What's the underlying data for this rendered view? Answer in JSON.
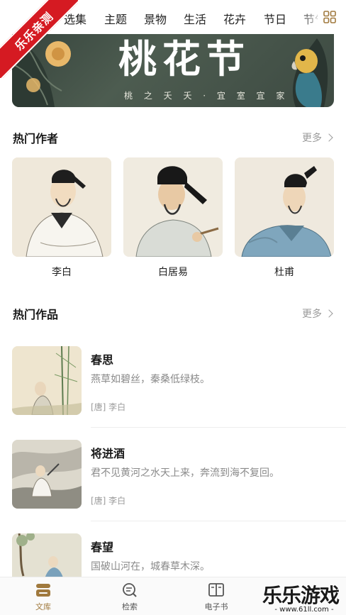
{
  "nav": {
    "tabs": [
      "选集",
      "主题",
      "景物",
      "生活",
      "花卉",
      "节日",
      "节气"
    ],
    "grid_icon": "grid-icon"
  },
  "watermark_ribbon": "乐乐亲测",
  "banner": {
    "title": "桃花节",
    "subtitle": "桃 之 夭 夭 · 宜 室 宜 家"
  },
  "hot_authors": {
    "title": "热门作者",
    "more": "更多",
    "items": [
      {
        "name": "李白"
      },
      {
        "name": "白居易"
      },
      {
        "name": "杜甫"
      }
    ]
  },
  "hot_works": {
    "title": "热门作品",
    "more": "更多",
    "items": [
      {
        "title": "春思",
        "line": "燕草如碧丝，秦桑低绿枝。",
        "author": "[唐] 李白"
      },
      {
        "title": "将进酒",
        "line": "君不见黄河之水天上来，奔流到海不复回。",
        "author": "[唐] 李白"
      },
      {
        "title": "春望",
        "line": "国破山河在，城春草木深。",
        "author": ""
      }
    ]
  },
  "tabbar": {
    "items": [
      {
        "label": "文库",
        "icon": "library-icon"
      },
      {
        "label": "检索",
        "icon": "search-icon"
      },
      {
        "label": "电子书",
        "icon": "book-icon"
      }
    ]
  },
  "watermark": {
    "big": "乐乐游戏",
    "small": "- www.61ll.com -"
  },
  "colors": {
    "accent": "#a0793d",
    "ribbon": "#d51a22",
    "banner_bg": "#3f4c44"
  }
}
